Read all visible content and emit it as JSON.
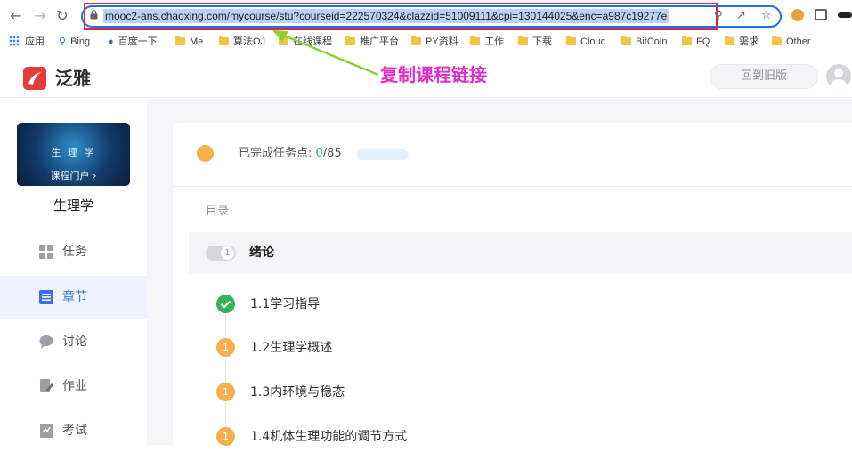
{
  "browser": {
    "url": "mooc2-ans.chaoxing.com/mycourse/stu?courseid=222570324&clazzid=51009111&cpi=130144025&enc=a987c19277e",
    "bookmarks": [
      "应用",
      "Bing",
      "百度一下",
      "Me",
      "算法OJ",
      "在线课程",
      "推广平台",
      "PY资料",
      "工作",
      "下载",
      "Cloud",
      "BitCoin",
      "FQ",
      "需求",
      "Other"
    ]
  },
  "header": {
    "logo_text": "泛雅",
    "annotation": "复制课程链接",
    "old_version_button": "回到旧版"
  },
  "sidebar": {
    "course_image_title": "生 理 学",
    "course_portal": "课程门户 ›",
    "course_name": "生理学",
    "items": [
      {
        "label": "任务",
        "icon": "grid-icon"
      },
      {
        "label": "章节",
        "icon": "list-icon",
        "active": true
      },
      {
        "label": "讨论",
        "icon": "chat-icon"
      },
      {
        "label": "作业",
        "icon": "edit-icon"
      },
      {
        "label": "考试",
        "icon": "exam-icon"
      }
    ]
  },
  "main": {
    "progress_label": "已完成任务点: ",
    "progress_done": "0",
    "progress_total": "/85",
    "toc_label": "目录",
    "unit": {
      "number": "1",
      "title": "绪论"
    },
    "sections": [
      {
        "status": "done",
        "badge": "",
        "title": "1.1学习指导"
      },
      {
        "status": "todo",
        "badge": "1",
        "title": "1.2生理学概述"
      },
      {
        "status": "todo",
        "badge": "1",
        "title": "1.3内环境与稳态"
      },
      {
        "status": "todo",
        "badge": "1",
        "title": "1.4机体生理功能的调节方式"
      }
    ]
  },
  "colors": {
    "accent": "#3a6df0",
    "done": "#34b35a",
    "todo": "#f5b04c",
    "annotation": "#e02ec8",
    "url_highlight_border": "#e0283c"
  }
}
